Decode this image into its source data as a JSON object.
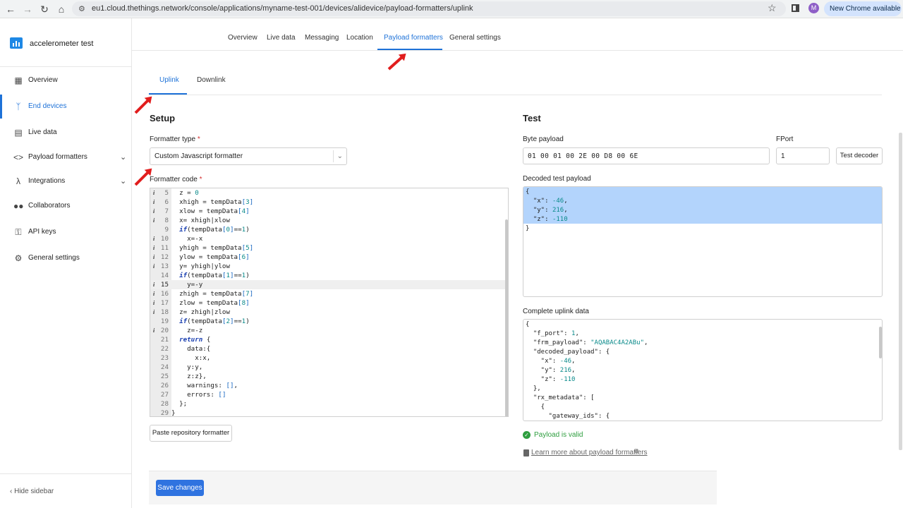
{
  "browser": {
    "url": "eu1.cloud.thethings.network/console/applications/myname-test-001/devices/alidevice/payload-formatters/uplink",
    "profile_initial": "M",
    "update_label": "New Chrome available"
  },
  "sidebar": {
    "app_name": "accelerometer test",
    "items": [
      {
        "label": "Overview",
        "icon": "grid-icon"
      },
      {
        "label": "End devices",
        "icon": "devices-icon"
      },
      {
        "label": "Live data",
        "icon": "list-icon"
      },
      {
        "label": "Payload formatters",
        "icon": "code-icon"
      },
      {
        "label": "Integrations",
        "icon": "integrations-icon"
      },
      {
        "label": "Collaborators",
        "icon": "people-icon"
      },
      {
        "label": "API keys",
        "icon": "key-icon"
      },
      {
        "label": "General settings",
        "icon": "gear-icon"
      }
    ],
    "active_item": "End devices",
    "hide_label": "Hide sidebar"
  },
  "top_tabs": [
    "Overview",
    "Live data",
    "Messaging",
    "Location",
    "Payload formatters",
    "General settings"
  ],
  "active_top_tab": "Payload formatters",
  "sub_tabs": [
    "Uplink",
    "Downlink"
  ],
  "active_sub_tab": "Uplink",
  "setup": {
    "title": "Setup",
    "formatter_type_label": "Formatter type",
    "formatter_type_value": "Custom Javascript formatter",
    "formatter_code_label": "Formatter code",
    "required_mark": "*",
    "paste_button": "Paste repository formatter",
    "current_line": 15,
    "code_lines": [
      {
        "n": "5",
        "info": true,
        "text": "  z = 0"
      },
      {
        "n": "6",
        "info": true,
        "text": "  xhigh = tempData[3]"
      },
      {
        "n": "7",
        "info": true,
        "text": "  xlow = tempData[4]"
      },
      {
        "n": "8",
        "info": true,
        "text": "  x= xhigh|xlow"
      },
      {
        "n": "9",
        "info": false,
        "text": "  if(tempData[0]==1)"
      },
      {
        "n": "10",
        "info": true,
        "text": "    x=-x"
      },
      {
        "n": "11",
        "info": true,
        "text": "  yhigh = tempData[5]"
      },
      {
        "n": "12",
        "info": true,
        "text": "  ylow = tempData[6]"
      },
      {
        "n": "13",
        "info": true,
        "text": "  y= yhigh|ylow"
      },
      {
        "n": "14",
        "info": false,
        "text": "  if(tempData[1]==1)"
      },
      {
        "n": "15",
        "info": true,
        "text": "    y=-y"
      },
      {
        "n": "16",
        "info": true,
        "text": "  zhigh = tempData[7]"
      },
      {
        "n": "17",
        "info": true,
        "text": "  zlow = tempData[8]"
      },
      {
        "n": "18",
        "info": true,
        "text": "  z= zhigh|zlow"
      },
      {
        "n": "19",
        "info": false,
        "text": "  if(tempData[2]==1)"
      },
      {
        "n": "20",
        "info": true,
        "text": "    z=-z"
      },
      {
        "n": "21",
        "info": false,
        "text": "  return {"
      },
      {
        "n": "22",
        "info": false,
        "text": "    data:{"
      },
      {
        "n": "23",
        "info": false,
        "text": "      x:x,"
      },
      {
        "n": "24",
        "info": false,
        "text": "    y:y,"
      },
      {
        "n": "25",
        "info": false,
        "text": "    z:z},"
      },
      {
        "n": "26",
        "info": false,
        "text": "    warnings: [],"
      },
      {
        "n": "27",
        "info": false,
        "text": "    errors: []"
      },
      {
        "n": "28",
        "info": false,
        "text": "  };"
      },
      {
        "n": "29",
        "info": false,
        "text": "}"
      }
    ]
  },
  "test": {
    "title": "Test",
    "byte_payload_label": "Byte payload",
    "byte_payload_value": "01 00 01 00 2E 00 D8 00 6E",
    "fport_label": "FPort",
    "fport_value": "1",
    "test_button": "Test decoder",
    "decoded_label": "Decoded test payload",
    "decoded_lines": [
      "{",
      "  \"x\": -46,",
      "  \"y\": 216,",
      "  \"z\": -110",
      "}"
    ],
    "uplink_label": "Complete uplink data",
    "uplink_lines": [
      "{",
      "  \"f_port\": 1,",
      "  \"frm_payload\": \"AQABAC4A2ABu\",",
      "  \"decoded_payload\": {",
      "    \"x\": -46,",
      "    \"y\": 216,",
      "    \"z\": -110",
      "  },",
      "  \"rx_metadata\": [",
      "    {",
      "      \"gateway_ids\": {"
    ],
    "valid_text": "Payload is valid",
    "learn_more": "Learn more about payload formatters"
  },
  "save_button": "Save changes",
  "colors": {
    "accent": "#1e72d8",
    "annotation_arrow": "#e11d1d",
    "valid": "#2e9e3f"
  }
}
